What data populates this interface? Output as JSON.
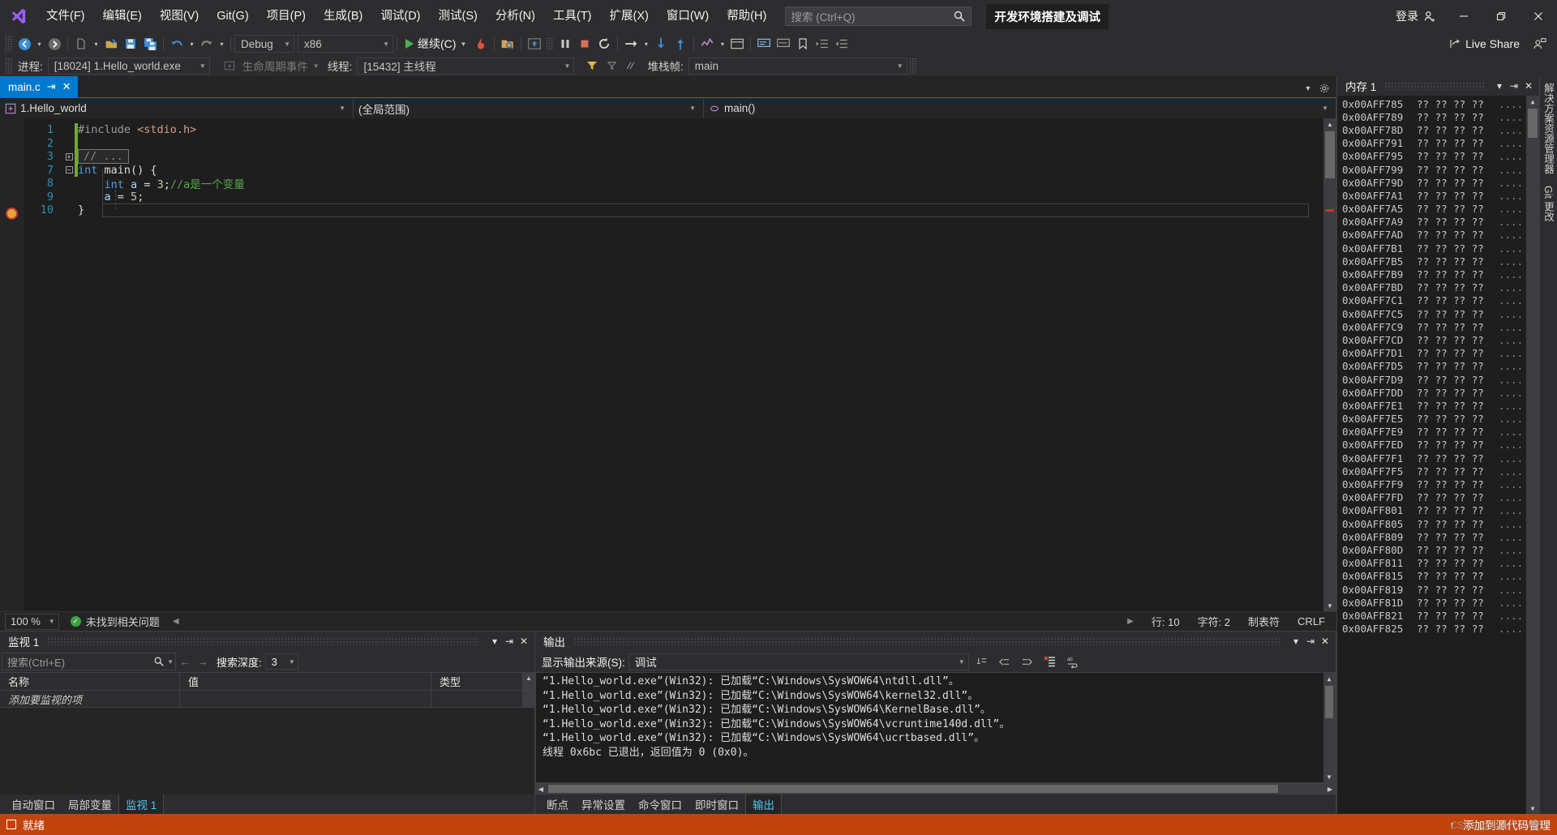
{
  "titlebar": {
    "logo_icon": "visual-studio-logo",
    "menus": [
      "文件(F)",
      "编辑(E)",
      "视图(V)",
      "Git(G)",
      "项目(P)",
      "生成(B)",
      "调试(D)",
      "测试(S)",
      "分析(N)",
      "工具(T)",
      "扩展(X)",
      "窗口(W)",
      "帮助(H)"
    ],
    "search_placeholder": "搜索 (Ctrl+Q)",
    "search_icon": "search-icon",
    "solution_tag": "开发环境搭建及调试",
    "signin_label": "登录",
    "signin_icon": "account-add-icon",
    "minimize_icon": "minimize-icon",
    "restore_icon": "restore-icon",
    "close_icon": "close-icon"
  },
  "toolbar": {
    "nav_back_icon": "navigate-back-icon",
    "nav_forward_icon": "navigate-forward-icon",
    "new_file_icon": "new-file-icon",
    "open_file_icon": "open-file-icon",
    "save_icon": "save-icon",
    "save_all_icon": "save-all-icon",
    "undo_icon": "undo-icon",
    "redo_icon": "redo-icon",
    "config_value": "Debug",
    "platform_value": "x86",
    "continue_label": "继续(C)",
    "hot_reload_icon": "hot-reload-icon",
    "attach_icon": "attach-to-process-icon",
    "show_next_statement_icon": "show-next-statement-icon",
    "break_all_icon": "break-all-icon",
    "stop_debug_icon": "stop-debugging-icon",
    "restart_icon": "restart-debugging-icon",
    "step_over_icon": "step-over-icon",
    "step_into_icon": "step-into-icon",
    "step_out_icon": "step-out-icon",
    "live_share_label": "Live Share",
    "live_share_icon": "live-share-icon",
    "feedback_icon": "send-feedback-icon"
  },
  "debugbar": {
    "process_label": "进程:",
    "process_value": "[18024] 1.Hello_world.exe",
    "lifecycle_label": "生命周期事件",
    "lifecycle_icon": "lifecycle-events-icon",
    "thread_label": "线程:",
    "thread_value": "[15432] 主线程",
    "filter_icon": "filter-icon",
    "flag_icon": "flag-icon",
    "stackframe_label": "堆栈帧:",
    "stackframe_value": "main"
  },
  "editor": {
    "tab_label": "main.c",
    "tab_pin_icon": "pin-icon",
    "tab_close_icon": "close-icon",
    "nav_project": "1.Hello_world",
    "nav_project_icon": "project-icon",
    "nav_scope": "(全局范围)",
    "nav_member": "main()",
    "nav_member_icon": "method-icon",
    "lines": [
      {
        "num": "1",
        "tokens": [
          {
            "t": "#include ",
            "c": "pp"
          },
          {
            "t": "<stdio.h>",
            "c": "str"
          }
        ]
      },
      {
        "num": "2",
        "tokens": []
      },
      {
        "num": "3",
        "collapsed": "// ...",
        "tokens": []
      },
      {
        "num": "7",
        "fold": "minus",
        "tokens": [
          {
            "t": "int",
            "c": "k"
          },
          {
            "t": " ",
            "c": "pl"
          },
          {
            "t": "main",
            "c": "pl"
          },
          {
            "t": "() {",
            "c": "pl"
          }
        ]
      },
      {
        "num": "8",
        "tokens": [
          {
            "t": "    ",
            "c": "pl"
          },
          {
            "t": "int",
            "c": "k"
          },
          {
            "t": " ",
            "c": "pl"
          },
          {
            "t": "a",
            "c": "id"
          },
          {
            "t": " = ",
            "c": "pl"
          },
          {
            "t": "3",
            "c": "num"
          },
          {
            "t": ";",
            "c": "pl"
          },
          {
            "t": "//a是一个变量",
            "c": "cm"
          }
        ],
        "breakpoint": true
      },
      {
        "num": "9",
        "tokens": [
          {
            "t": "    ",
            "c": "pl"
          },
          {
            "t": "a",
            "c": "id"
          },
          {
            "t": " = ",
            "c": "pl"
          },
          {
            "t": "5",
            "c": "num"
          },
          {
            "t": ";",
            "c": "pl"
          }
        ]
      },
      {
        "num": "10",
        "tokens": [
          {
            "t": "}",
            "c": "pl"
          }
        ],
        "caret": true
      }
    ],
    "status": {
      "zoom": "100 %",
      "problems": "未找到相关问题",
      "problems_icon": "check-circle-icon",
      "line_label": "行: 10",
      "char_label": "字符: 2",
      "tabs_label": "制表符",
      "eol_label": "CRLF"
    }
  },
  "watch": {
    "title": "监视 1",
    "dropdown_icon": "chevron-down-icon",
    "pin_icon": "pin-icon",
    "close_icon": "close-icon",
    "search_placeholder": "搜索(Ctrl+E)",
    "search_icon": "search-icon",
    "prev_icon": "arrow-left-icon",
    "next_icon": "arrow-right-icon",
    "depth_label": "搜索深度:",
    "depth_value": "3",
    "columns": [
      "名称",
      "值",
      "类型"
    ],
    "rows": [
      {
        "name": "添加要监视的项",
        "value": "",
        "type": ""
      }
    ],
    "tabs": [
      "自动窗口",
      "局部变量",
      "监视 1"
    ],
    "selected_tab": "监视 1"
  },
  "output": {
    "title": "输出",
    "dropdown_icon": "chevron-down-icon",
    "pin_icon": "pin-icon",
    "close_icon": "close-icon",
    "source_label": "显示输出来源(S):",
    "source_value": "调试",
    "find_msg_icon": "find-message-icon",
    "go_prev_icon": "go-to-previous-icon",
    "go_next_icon": "go-to-next-icon",
    "clear_icon": "clear-all-icon",
    "wordwrap_icon": "word-wrap-icon",
    "lines": [
      "“1.Hello_world.exe”(Win32): 已加载“C:\\Windows\\SysWOW64\\ntdll.dll”。",
      "“1.Hello_world.exe”(Win32): 已加载“C:\\Windows\\SysWOW64\\kernel32.dll”。",
      "“1.Hello_world.exe”(Win32): 已加载“C:\\Windows\\SysWOW64\\KernelBase.dll”。",
      "“1.Hello_world.exe”(Win32): 已加载“C:\\Windows\\SysWOW64\\vcruntime140d.dll”。",
      "“1.Hello_world.exe”(Win32): 已加载“C:\\Windows\\SysWOW64\\ucrtbased.dll”。",
      "线程 0x6bc 已退出，返回值为 0 (0x0)。"
    ],
    "tabs": [
      "断点",
      "异常设置",
      "命令窗口",
      "即时窗口",
      "输出"
    ],
    "selected_tab": "输出"
  },
  "memory": {
    "title": "内存 1",
    "dropdown_icon": "chevron-down-icon",
    "pin_icon": "pin-icon",
    "close_icon": "close-icon",
    "hex_cell": "?? ?? ?? ??",
    "ascii_cell": "....",
    "addresses": [
      "0x00AFF785",
      "0x00AFF789",
      "0x00AFF78D",
      "0x00AFF791",
      "0x00AFF795",
      "0x00AFF799",
      "0x00AFF79D",
      "0x00AFF7A1",
      "0x00AFF7A5",
      "0x00AFF7A9",
      "0x00AFF7AD",
      "0x00AFF7B1",
      "0x00AFF7B5",
      "0x00AFF7B9",
      "0x00AFF7BD",
      "0x00AFF7C1",
      "0x00AFF7C5",
      "0x00AFF7C9",
      "0x00AFF7CD",
      "0x00AFF7D1",
      "0x00AFF7D5",
      "0x00AFF7D9",
      "0x00AFF7DD",
      "0x00AFF7E1",
      "0x00AFF7E5",
      "0x00AFF7E9",
      "0x00AFF7ED",
      "0x00AFF7F1",
      "0x00AFF7F5",
      "0x00AFF7F9",
      "0x00AFF7FD",
      "0x00AFF801",
      "0x00AFF805",
      "0x00AFF809",
      "0x00AFF80D",
      "0x00AFF811",
      "0x00AFF815",
      "0x00AFF819",
      "0x00AFF81D",
      "0x00AFF821",
      "0x00AFF825"
    ]
  },
  "rail": {
    "items": [
      "解决方案资源管理器",
      "Git 更改"
    ]
  },
  "statusbar": {
    "state_icon": "ready-icon",
    "state_label": "就绪",
    "right_icon": "up-arrow-icon",
    "right_label": "添加到源代码管理",
    "watermark": "CSDN @老大个小猪仔"
  },
  "colors": {
    "accent": "#007acc",
    "debug_status": "#c1440e",
    "chrome": "#2d2d30",
    "editor_bg": "#1e1e1e"
  }
}
